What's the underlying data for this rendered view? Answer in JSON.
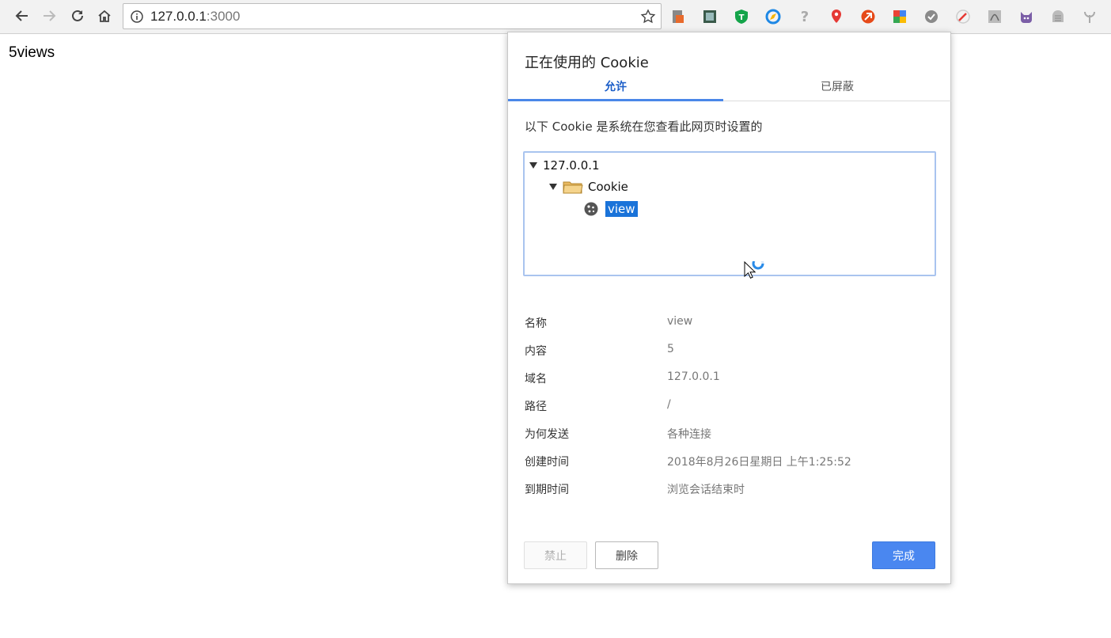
{
  "browser": {
    "url_host": "127.0.0.1",
    "url_port": ":3000"
  },
  "page": {
    "body_text": "5views"
  },
  "dialog": {
    "title": "正在使用的 Cookie",
    "tabs": [
      {
        "label": "允许",
        "active": true
      },
      {
        "label": "已屏蔽",
        "active": false
      }
    ],
    "description": "以下 Cookie 是系统在您查看此网页时设置的",
    "tree": {
      "host": "127.0.0.1",
      "folder": "Cookie",
      "cookie": "view"
    },
    "details": [
      {
        "key": "名称",
        "value": "view"
      },
      {
        "key": "内容",
        "value": "5"
      },
      {
        "key": "域名",
        "value": "127.0.0.1"
      },
      {
        "key": "路径",
        "value": "/"
      },
      {
        "key": "为何发送",
        "value": "各种连接"
      },
      {
        "key": "创建时间",
        "value": "2018年8月26日星期日 上午1:25:52"
      },
      {
        "key": "到期时间",
        "value": "浏览会话结束时"
      }
    ],
    "buttons": {
      "block": "禁止",
      "remove": "删除",
      "done": "完成"
    }
  },
  "colors": {
    "accent": "#4a87f0",
    "tab_active": "#1a5dc8",
    "selection": "#1a73d9"
  },
  "icons": [
    "back-icon",
    "forward-icon",
    "reload-icon",
    "home-icon",
    "info-icon",
    "star-icon",
    "folder-icon",
    "cookie-icon",
    "cursor-icon"
  ]
}
